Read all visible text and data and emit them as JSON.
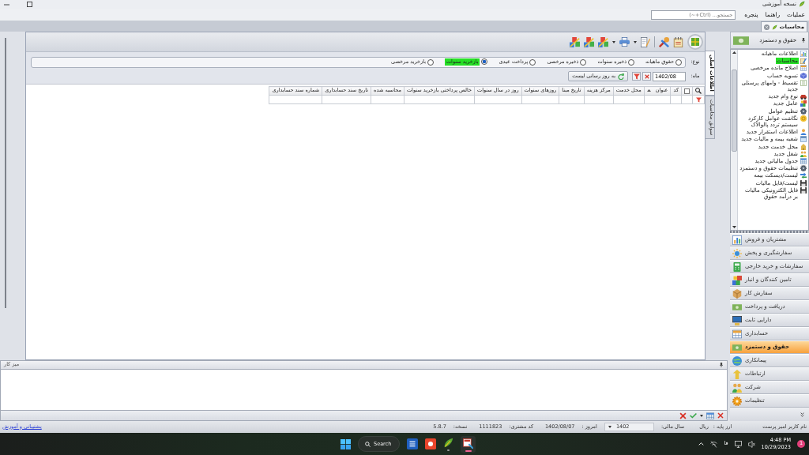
{
  "window": {
    "title": "نسخه آموزشی"
  },
  "menu": [
    "عملیات",
    "راهنما",
    "پنجره"
  ],
  "search": {
    "placeholder": "جستجو... (Ctrl+~)"
  },
  "tabs": [
    {
      "label": "محاسبات",
      "selected": true
    }
  ],
  "side_tabs": [
    {
      "label": "اطلاعات اصلی",
      "selected": true
    },
    {
      "label": "سوابق محاسبات",
      "selected": false
    }
  ],
  "form": {
    "type_label": "نوع:",
    "types": [
      {
        "label": "حقوق ماهیانه",
        "selected": false
      },
      {
        "label": "ذخیره سنوات",
        "selected": false
      },
      {
        "label": "ذخیره مرخصی",
        "selected": false
      },
      {
        "label": "پرداخت عیدی",
        "selected": false
      },
      {
        "label": "بازخرید سنوات",
        "selected": true
      },
      {
        "label": "بازخرید مرخصی",
        "selected": false
      }
    ],
    "month_label": "ماه:",
    "month": "1402/08",
    "refresh_button": "به روز رسانی لیست"
  },
  "table": {
    "select_all_checked": false,
    "columns": [
      {
        "label": "کد",
        "sorted": false
      },
      {
        "label": "عنوان",
        "sorted": true
      },
      {
        "label": "محل خدمت",
        "sorted": false
      },
      {
        "label": "مرکز هزینه",
        "sorted": false
      },
      {
        "label": "تاریخ مبنا",
        "sorted": false
      },
      {
        "label": "روزهای سنوات",
        "sorted": false
      },
      {
        "label": "روز در سال سنوات",
        "sorted": false
      },
      {
        "label": "خالص پرداختی بازخرید سنوات",
        "sorted": false
      },
      {
        "label": "محاسبه شده",
        "sorted": false
      },
      {
        "label": "تاریخ سند حسابداری",
        "sorted": false
      },
      {
        "label": "شماره سند حسابداری",
        "sorted": false
      }
    ]
  },
  "workspace": {
    "title": "میز کار"
  },
  "sidebar": {
    "title": "حقوق و دستمزد",
    "items": [
      {
        "label": "اطلاعات ماهیانه",
        "selected": false
      },
      {
        "label": "محاسبات",
        "selected": true
      },
      {
        "label": "اصلاح مانده مرخصی",
        "selected": false
      },
      {
        "label": "تسویه حساب",
        "selected": false
      },
      {
        "label": "تقسیط - وامهای پرسنلی جدید",
        "selected": false
      },
      {
        "label": "نوع وام جدید",
        "selected": false
      },
      {
        "label": "عامل جدید",
        "selected": false
      },
      {
        "label": "تنظیم عوامل",
        "selected": false
      },
      {
        "label": "نگاشت عوامل کارکرد سیستم تردد پالوالاک",
        "selected": false
      },
      {
        "label": "اطلاعات استقرار جدید",
        "selected": false
      },
      {
        "label": "شعبه بیمه و مالیات جدید",
        "selected": false
      },
      {
        "label": "محل خدمت جدید",
        "selected": false
      },
      {
        "label": "شغل جدید",
        "selected": false
      },
      {
        "label": "جدول مالیاتی جدید",
        "selected": false
      },
      {
        "label": "تنظیمات حقوق و دستمزد",
        "selected": false
      },
      {
        "label": "لیست/دیسکت بیمه",
        "selected": false
      },
      {
        "label": "لیست/فایل مالیات",
        "selected": false
      },
      {
        "label": "فایل الکترونیکی مالیات بر درآمد حقوق",
        "selected": false
      }
    ],
    "modules": [
      {
        "label": "مشتریان و فروش",
        "selected": false
      },
      {
        "label": "سفارشگیری و پخش",
        "selected": false
      },
      {
        "label": "سفارشات و خرید خارجی",
        "selected": false
      },
      {
        "label": "تامین کنندگان و انبار",
        "selected": false
      },
      {
        "label": "سفارش کار",
        "selected": false
      },
      {
        "label": "دریافت و پرداخت",
        "selected": false
      },
      {
        "label": "دارایی ثابت",
        "selected": false
      },
      {
        "label": "حسابداری",
        "selected": false
      },
      {
        "label": "حقوق و دستمزد",
        "selected": true
      },
      {
        "label": "پیمانکاری",
        "selected": false
      },
      {
        "label": "ارتباطات",
        "selected": false
      },
      {
        "label": "شرکت",
        "selected": false
      },
      {
        "label": "تنظیمات",
        "selected": false
      }
    ]
  },
  "status_bar": {
    "user": "نام کاربر امیر پرست",
    "base_currency_label": "ارز پایه :",
    "base_currency": "ریال",
    "fiscal_year_label": "سال مالی:",
    "fiscal_year": "1402",
    "today_label": "امروز :",
    "today": "1402/08/07",
    "customer_code_label": "کد مشتری:",
    "customer_code": "1111823",
    "version_label": "نسخه:",
    "version": "5.8.7",
    "support_link": "پشتیبانی و آموزش"
  },
  "taskbar": {
    "search": "Search",
    "language": "فا",
    "time": "4:48 PM",
    "date": "10/29/2023",
    "notifications": "1"
  }
}
